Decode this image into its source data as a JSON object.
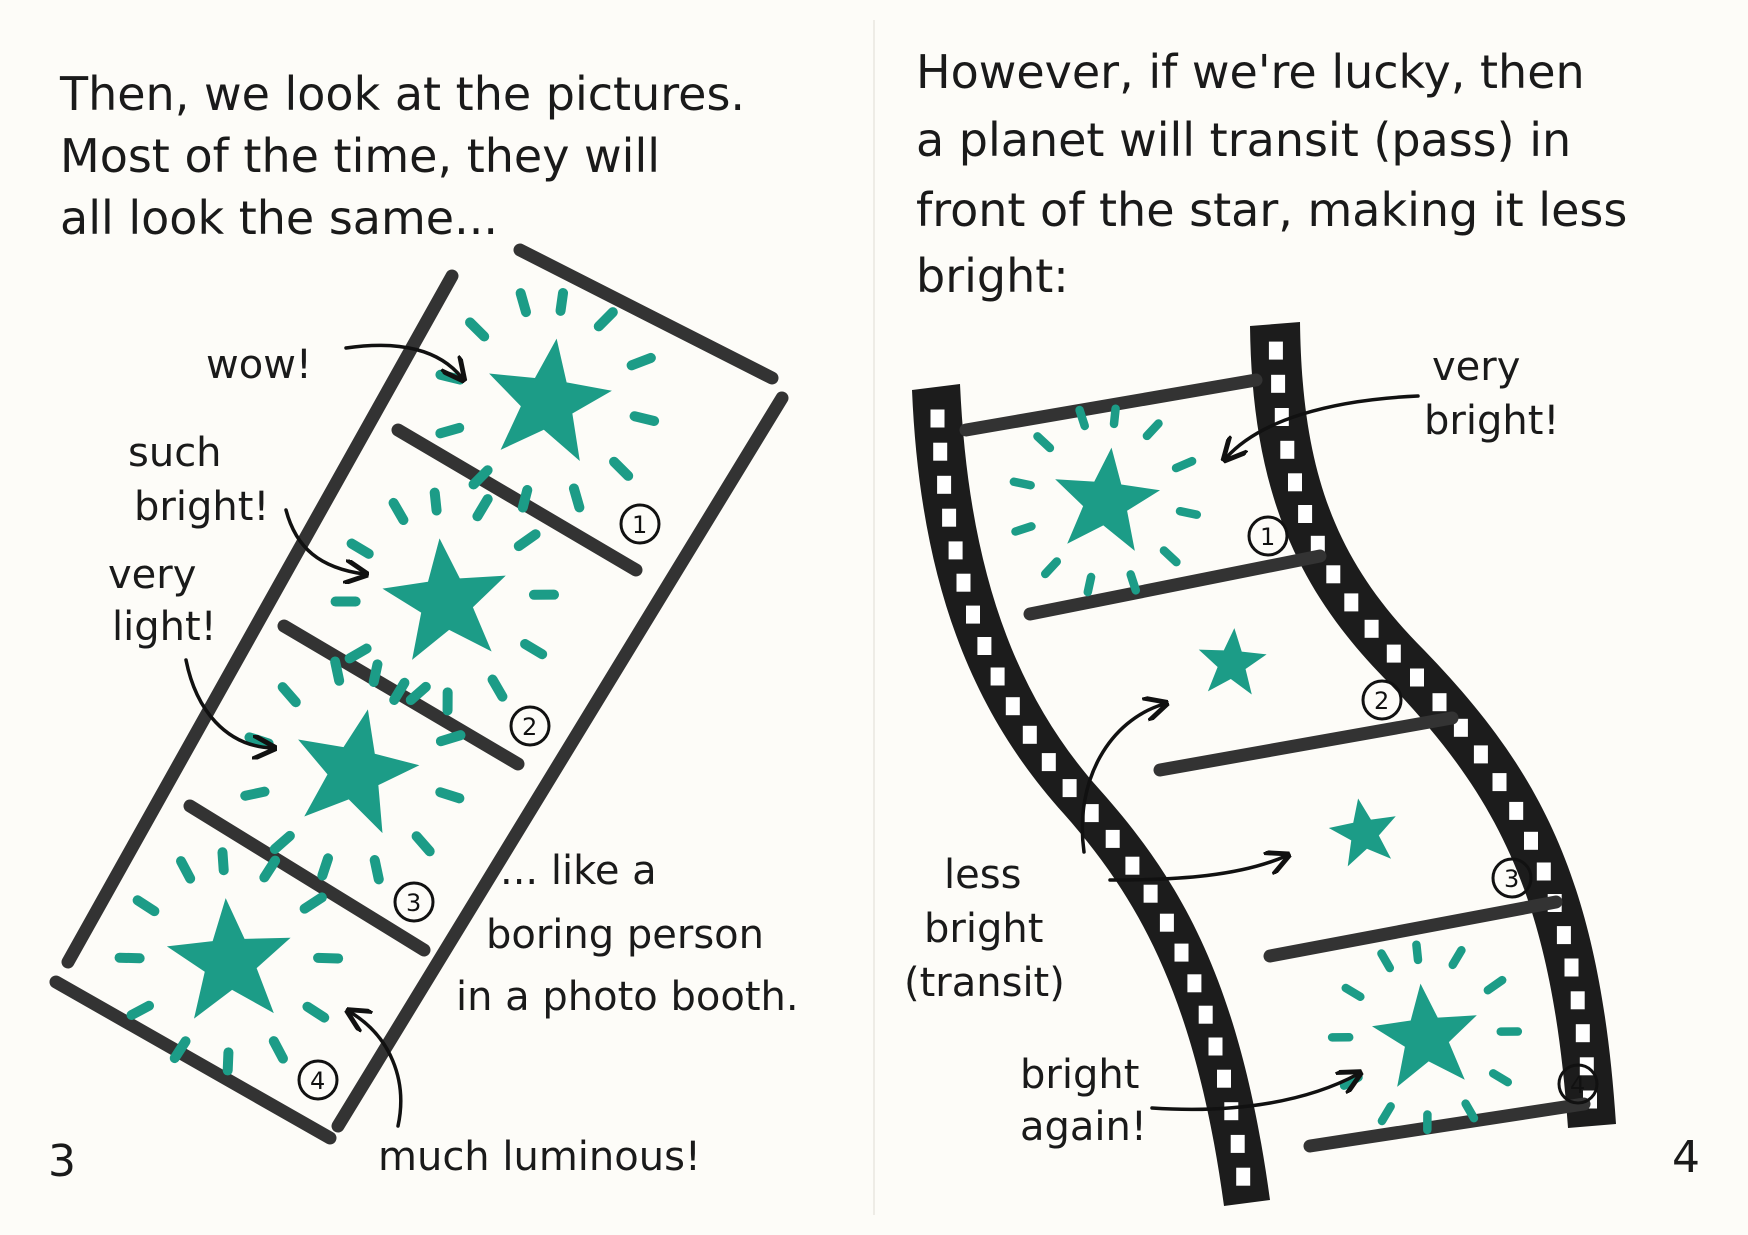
{
  "left_page": {
    "caption_lines": [
      "Then, we look at the pictures.",
      "Most of the time, they will",
      "all look the same..."
    ],
    "notes": {
      "wow": "wow!",
      "such_bright": [
        "such",
        "bright!"
      ],
      "very_light": [
        "very",
        "light!"
      ],
      "much_luminous": "much luminous!",
      "boring_person": [
        "... like a",
        "boring person",
        "in a photo booth."
      ]
    },
    "frame_numbers": [
      "1",
      "2",
      "3",
      "4"
    ],
    "page_number": "3"
  },
  "right_page": {
    "caption_lines": [
      "However, if we're lucky, then",
      "a planet will transit (pass) in",
      "front of the star, making it less",
      "bright:"
    ],
    "notes": {
      "very_bright": [
        "very",
        "bright!"
      ],
      "less_bright": [
        "less",
        "bright",
        "(transit)"
      ],
      "bright_again": [
        "bright",
        "again!"
      ]
    },
    "frame_numbers": [
      "1",
      "2",
      "3",
      "4"
    ],
    "page_number": "4"
  },
  "colors": {
    "star": "#1c9c87",
    "ink": "#1a1a1a",
    "film": "#1c1c1c",
    "paper": "#fdfcf8"
  }
}
